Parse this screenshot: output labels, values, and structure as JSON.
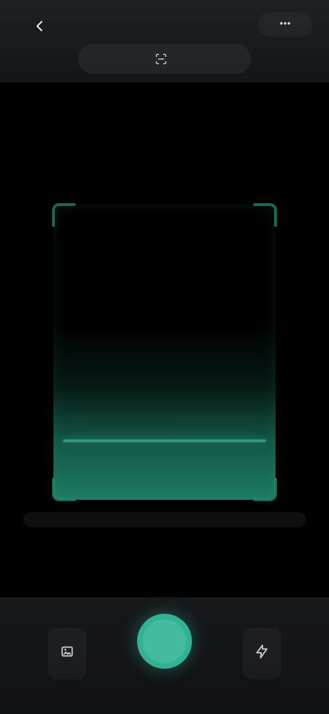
{
  "colors": {
    "accent": "#2fb394",
    "background": "#000000",
    "topbar": "#1f2022",
    "bottombar": "#17181a"
  },
  "topbar": {
    "back_icon": "back-arrow-icon",
    "title": "",
    "title_icon": "scan-icon",
    "menu_icon": "more-icon"
  },
  "viewfinder": {
    "hint_text": ""
  },
  "bottombar": {
    "left": {
      "label": "",
      "icon": "image-icon"
    },
    "shutter": {
      "label": ""
    },
    "right": {
      "label": "",
      "icon": "flash-icon"
    }
  }
}
